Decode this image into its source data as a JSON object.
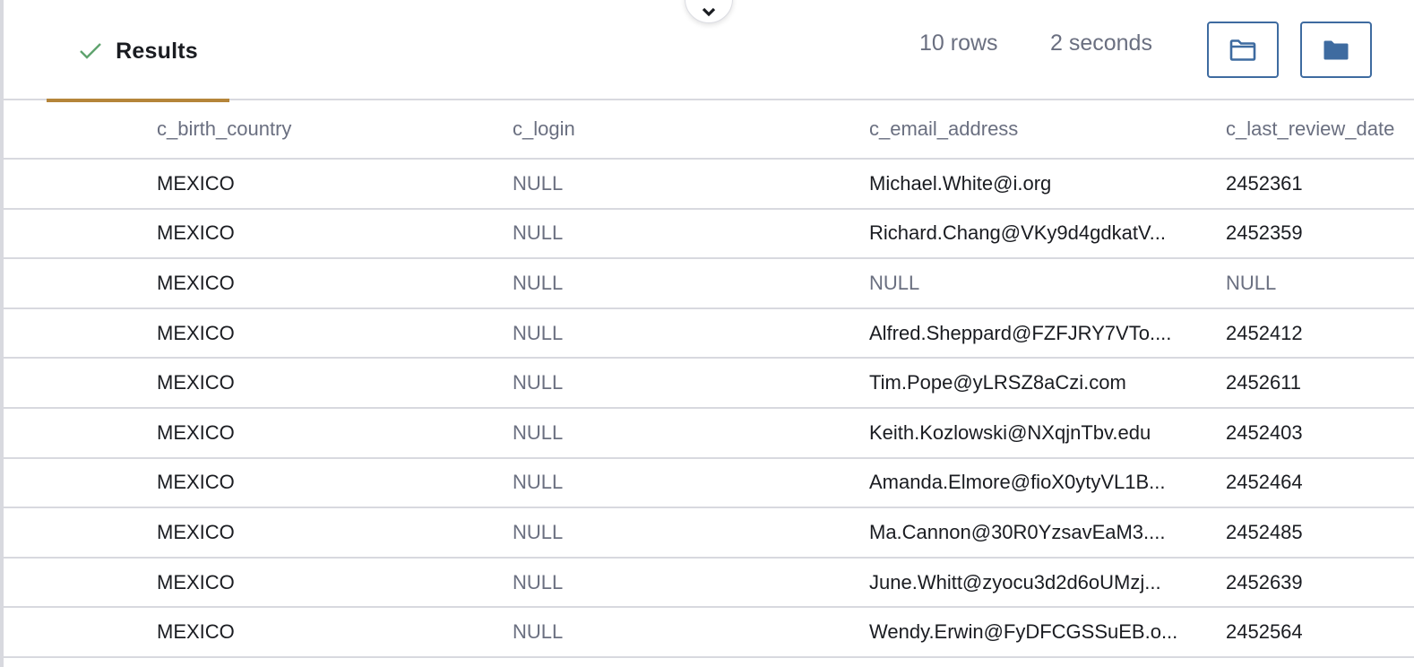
{
  "results_tab": {
    "label": "Results",
    "status_icon": "check-icon",
    "accent_color": "#b5853a",
    "check_color": "#5fa36e"
  },
  "stats": {
    "rows": "10 rows",
    "duration": "2 seconds"
  },
  "toolbar": {
    "open_icon": "folder-outline-icon",
    "solid_icon": "folder-solid-icon",
    "button_color": "#3e6ba0"
  },
  "collapse_handle": {
    "icon": "chevron-down-icon"
  },
  "table": {
    "columns": [
      "c_birth_country",
      "c_login",
      "c_email_address",
      "c_last_review_date"
    ],
    "rows": [
      [
        "MEXICO",
        "NULL",
        "Michael.White@i.org",
        "2452361"
      ],
      [
        "MEXICO",
        "NULL",
        "Richard.Chang@VKy9d4gdkatV...",
        "2452359"
      ],
      [
        "MEXICO",
        "NULL",
        "NULL",
        "NULL"
      ],
      [
        "MEXICO",
        "NULL",
        "Alfred.Sheppard@FZFJRY7VTo....",
        "2452412"
      ],
      [
        "MEXICO",
        "NULL",
        "Tim.Pope@yLRSZ8aCzi.com",
        "2452611"
      ],
      [
        "MEXICO",
        "NULL",
        "Keith.Kozlowski@NXqjnTbv.edu",
        "2452403"
      ],
      [
        "MEXICO",
        "NULL",
        "Amanda.Elmore@fioX0ytyVL1B...",
        "2452464"
      ],
      [
        "MEXICO",
        "NULL",
        "Ma.Cannon@30R0YzsavEaM3....",
        "2452485"
      ],
      [
        "MEXICO",
        "NULL",
        "June.Whitt@zyocu3d2d6oUMzj...",
        "2452639"
      ],
      [
        "MEXICO",
        "NULL",
        "Wendy.Erwin@FyDFCGSSuEB.o...",
        "2452564"
      ]
    ]
  }
}
